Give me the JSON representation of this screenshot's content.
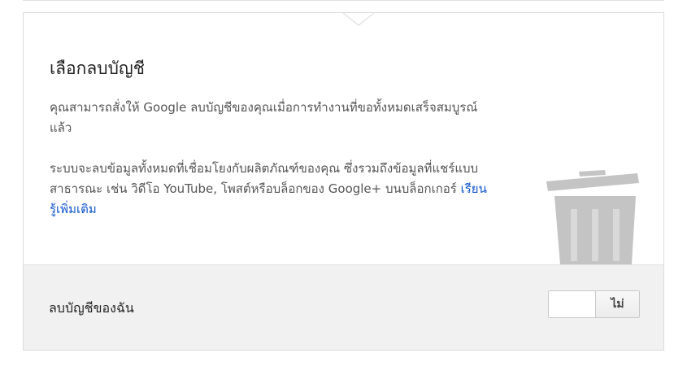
{
  "dialog": {
    "title": "เลือกลบบัญชี",
    "paragraph1": "คุณสามารถสั่งให้ Google ลบบัญชีของคุณเมื่อการทำงานที่ขอทั้งหมดเสร็จสมบูรณ์แล้ว",
    "paragraph2_text": "ระบบจะลบข้อมูลทั้งหมดที่เชื่อมโยงกับผลิตภัณฑ์ของคุณ ซึ่งรวมถึงข้อมูลที่แชร์แบบสาธารณะ เช่น วิดีโอ YouTube, โพสต์หรือบล็อกของ Google+ บนบล็อกเกอร์ ",
    "learn_more_link": "เรียนรู้เพิ่มเติม",
    "icon": "trash-can-icon"
  },
  "footer": {
    "label": "ลบบัญชีของฉัน",
    "toggle": {
      "state_label": "ไม่",
      "state": "off"
    }
  },
  "colors": {
    "link": "#1155cc",
    "footer_background": "#f1f1f1",
    "icon_gray": "#c4c4c4"
  }
}
